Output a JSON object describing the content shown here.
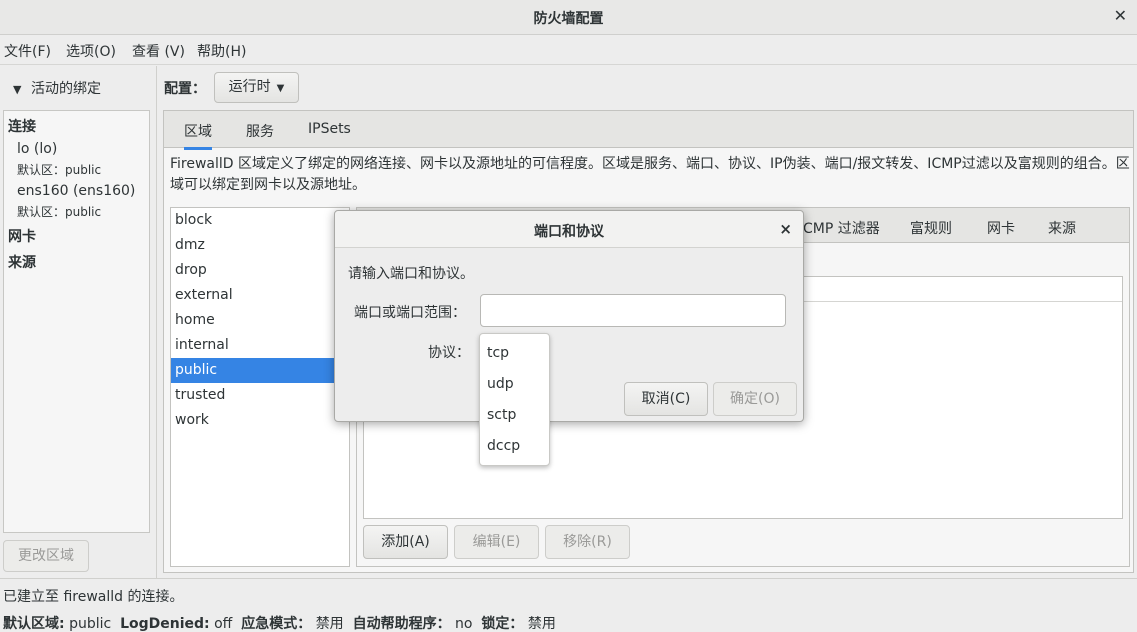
{
  "window": {
    "title": "防火墙配置",
    "close": "✕"
  },
  "menu": [
    "文件(F)",
    "选项(O)",
    "查看 (V)",
    "帮助(H)"
  ],
  "left": {
    "header": "活动的绑定",
    "connections_header": "连接",
    "connections": [
      {
        "name": "lo (lo)",
        "zone": "默认区：public"
      },
      {
        "name": "ens160 (ens160)",
        "zone": "默认区：public"
      }
    ],
    "nic_header": "网卡",
    "source_header": "来源",
    "change_zone_button": "更改区域"
  },
  "config": {
    "label": "配置：",
    "value": "运行时"
  },
  "tabs": [
    "区域",
    "服务",
    "IPSets"
  ],
  "description": "FirewallD 区域定义了绑定的网络连接、网卡以及源地址的可信程度。区域是服务、端口、协议、IP伪装、端口/报文转发、ICMP过滤以及富规则的组合。区域可以绑定到网卡以及源地址。",
  "zones": [
    "block",
    "dmz",
    "drop",
    "external",
    "home",
    "internal",
    "public",
    "trusted",
    "work"
  ],
  "selected_zone": "public",
  "inner_tabs": [
    "CMP 过滤器",
    "富规则",
    "网卡",
    "来源"
  ],
  "actions": {
    "add": "添加(A)",
    "edit": "编辑(E)",
    "remove": "移除(R)"
  },
  "status": {
    "connection": "已建立至 firewalld 的连接。",
    "default_zone_label": "默认区域:",
    "default_zone": "public",
    "logdenied_label": "LogDenied:",
    "logdenied": "off",
    "panic_label": "应急模式：",
    "panic": "禁用",
    "helper_label": "自动帮助程序：",
    "helper": "no",
    "lock_label": "锁定：",
    "lock": "禁用"
  },
  "dialog": {
    "title": "端口和协议",
    "close": "×",
    "prompt": "请输入端口和协议。",
    "port_label": "端口或端口范围：",
    "port_value": "",
    "protocol_label": "协议：",
    "protocol_options": [
      "tcp",
      "udp",
      "sctp",
      "dccp"
    ],
    "cancel": "取消(C)",
    "ok": "确定(O)"
  }
}
